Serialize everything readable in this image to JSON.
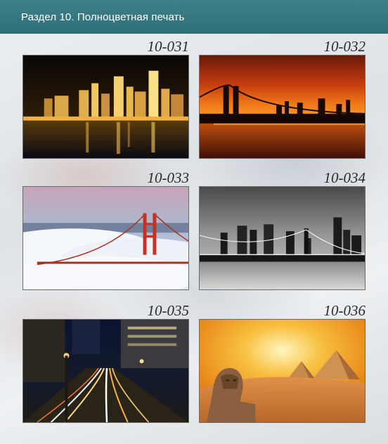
{
  "header": {
    "title": "Раздел 10. Полноцветная печать"
  },
  "catalog": {
    "items": [
      {
        "code": "10-031",
        "icon": "city-night-skyline-image"
      },
      {
        "code": "10-032",
        "icon": "bridge-sunset-image"
      },
      {
        "code": "10-033",
        "icon": "golden-gate-fog-image"
      },
      {
        "code": "10-034",
        "icon": "bw-city-bridge-image"
      },
      {
        "code": "10-035",
        "icon": "night-traffic-lights-image"
      },
      {
        "code": "10-036",
        "icon": "sphinx-pyramids-image"
      }
    ]
  }
}
